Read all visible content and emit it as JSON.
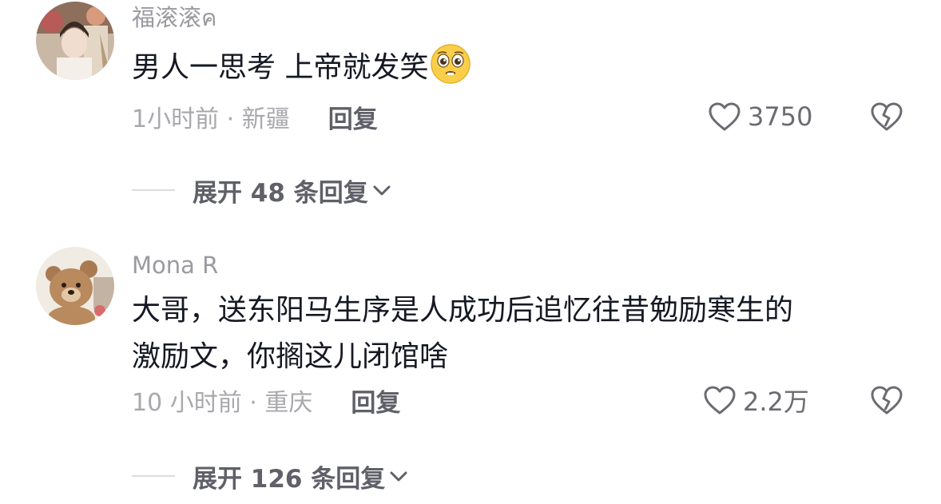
{
  "comments": [
    {
      "username": "福滚滚ค",
      "username_suffix": "ค",
      "text_lines": [
        "男人一思考 上帝就发笑"
      ],
      "emoji": "pleading-face-emoji",
      "time_location": "1小时前 · 新疆",
      "reply_label": "回复",
      "likes": "3750",
      "expand_label": "展开 48 条回复"
    },
    {
      "username": "Mona R",
      "text_lines": [
        "大哥，送东阳马生序是人成功后追忆往昔勉励寒生的",
        "激励文，你搁这儿闭馆啥"
      ],
      "time_location": "10 小时前 · 重庆",
      "reply_label": "回复",
      "likes": "2.2万",
      "expand_label": "展开 126 条回复"
    }
  ],
  "icons": {
    "like": "heart-outline-icon",
    "dislike": "broken-heart-icon",
    "expand": "chevron-down-icon"
  },
  "colors": {
    "text": "#161823",
    "muted": "#a8a8ad",
    "action": "#5f6068"
  }
}
